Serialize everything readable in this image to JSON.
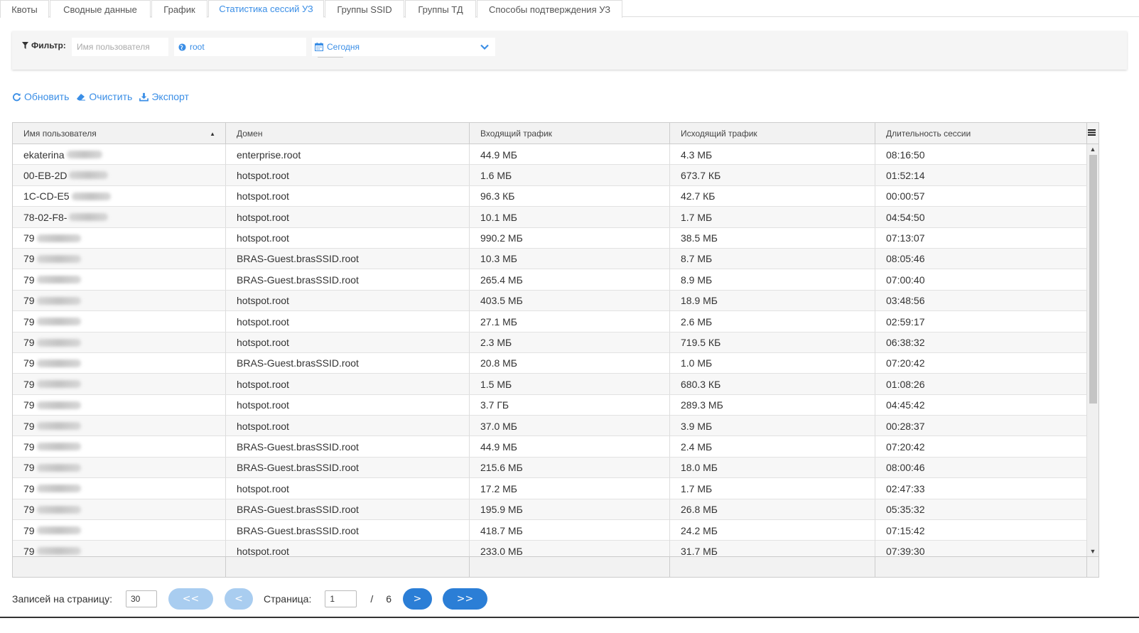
{
  "tabs": [
    {
      "label": "Квоты",
      "active": false
    },
    {
      "label": "Сводные данные",
      "active": false
    },
    {
      "label": "График",
      "active": false
    },
    {
      "label": "Статистика сессий УЗ",
      "active": true
    },
    {
      "label": "Группы SSID",
      "active": false
    },
    {
      "label": "Группы ТД",
      "active": false
    },
    {
      "label": "Способы подтверждения УЗ",
      "active": false
    }
  ],
  "filter": {
    "label": "Фильтр:",
    "username_placeholder": "Имя пользователя",
    "domain_value": "root",
    "date_value": "Сегодня"
  },
  "actions": {
    "refresh": "Обновить",
    "clear": "Очистить",
    "export": "Экспорт"
  },
  "grid": {
    "columns": [
      "Имя пользователя",
      "Домен",
      "Входящий трафик",
      "Исходящий трафик",
      "Длительность сессии"
    ],
    "sort_indicator": "▲",
    "rows": [
      [
        "ekaterina",
        "enterprise.root",
        "44.9 МБ",
        "4.3 МБ",
        "08:16:50"
      ],
      [
        "00-EB-2D",
        "hotspot.root",
        "1.6 МБ",
        "673.7 КБ",
        "01:52:14"
      ],
      [
        "1C-CD-E5",
        "hotspot.root",
        "96.3 КБ",
        "42.7 КБ",
        "00:00:57"
      ],
      [
        "78-02-F8-",
        "hotspot.root",
        "10.1 МБ",
        "1.7 МБ",
        "04:54:50"
      ],
      [
        "79",
        "hotspot.root",
        "990.2 МБ",
        "38.5 МБ",
        "07:13:07"
      ],
      [
        "79",
        "BRAS-Guest.brasSSID.root",
        "10.3 МБ",
        "8.7 МБ",
        "08:05:46"
      ],
      [
        "79",
        "BRAS-Guest.brasSSID.root",
        "265.4 МБ",
        "8.9 МБ",
        "07:00:40"
      ],
      [
        "79",
        "hotspot.root",
        "403.5 МБ",
        "18.9 МБ",
        "03:48:56"
      ],
      [
        "79",
        "hotspot.root",
        "27.1 МБ",
        "2.6 МБ",
        "02:59:17"
      ],
      [
        "79",
        "hotspot.root",
        "2.3 МБ",
        "719.5 КБ",
        "06:38:32"
      ],
      [
        "79",
        "BRAS-Guest.brasSSID.root",
        "20.8 МБ",
        "1.0 МБ",
        "07:20:42"
      ],
      [
        "79",
        "hotspot.root",
        "1.5 МБ",
        "680.3 КБ",
        "01:08:26"
      ],
      [
        "79",
        "hotspot.root",
        "3.7 ГБ",
        "289.3 МБ",
        "04:45:42"
      ],
      [
        "79",
        "hotspot.root",
        "37.0 МБ",
        "3.9 МБ",
        "00:28:37"
      ],
      [
        "79",
        "BRAS-Guest.brasSSID.root",
        "44.9 МБ",
        "2.4 МБ",
        "07:20:42"
      ],
      [
        "79",
        "BRAS-Guest.brasSSID.root",
        "215.6 МБ",
        "18.0 МБ",
        "08:00:46"
      ],
      [
        "79",
        "hotspot.root",
        "17.2 МБ",
        "1.7 МБ",
        "02:47:33"
      ],
      [
        "79",
        "BRAS-Guest.brasSSID.root",
        "195.9 МБ",
        "26.8 МБ",
        "05:35:32"
      ],
      [
        "79",
        "BRAS-Guest.brasSSID.root",
        "418.7 МБ",
        "24.2 МБ",
        "07:15:42"
      ],
      [
        "79",
        "hotspot.root",
        "233.0 МБ",
        "31.7 МБ",
        "07:39:30"
      ]
    ]
  },
  "pager": {
    "per_page_label": "Записей на страницу:",
    "per_page_value": "30",
    "first": "<<",
    "prev": "<",
    "page_label": "Страница:",
    "page_value": "1",
    "separator": "/",
    "total_pages": "6",
    "next": ">",
    "last": ">>"
  },
  "colors": {
    "accent": "#3a8ee6",
    "button_enabled": "#2b7ed6",
    "button_disabled": "#a9cdf0"
  }
}
